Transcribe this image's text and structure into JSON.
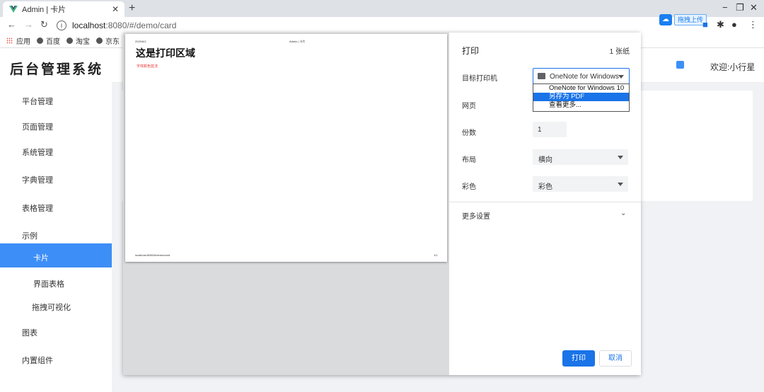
{
  "browser": {
    "tab_title": "Admin | 卡片",
    "new_tab": "+",
    "url_host": "localhost",
    "url_path": ":8080/#/demo/card",
    "window_controls": [
      "−",
      "❐",
      "✕"
    ],
    "upload_ext_label": "拖拽上传",
    "bookmarks": [
      "应用",
      "百度",
      "淘宝",
      "京东"
    ]
  },
  "app": {
    "title": "后台管理系统",
    "welcome": "欢迎:小行星",
    "accent": "#3d8ef7",
    "menu": [
      {
        "label": "平台管理",
        "active": false
      },
      {
        "label": "页面管理",
        "active": false
      },
      {
        "label": "系统管理",
        "active": false
      },
      {
        "label": "字典管理",
        "active": false
      },
      {
        "label": "表格管理",
        "active": false
      },
      {
        "label": "示例",
        "active": false
      },
      {
        "label": "卡片",
        "active": true
      },
      {
        "label": "界面表格",
        "active": false
      },
      {
        "label": "拖拽可视化",
        "active": false
      },
      {
        "label": "图表",
        "active": false
      },
      {
        "label": "内置组件",
        "active": false
      }
    ]
  },
  "print_preview": {
    "date": "2020/6/2",
    "header": "Admin | 卡片",
    "title": "这是打印区域",
    "note": "字体颜色蓝洼",
    "footer_url": "localhost:8080/#/demo/card",
    "page_num": "1/1"
  },
  "print_settings": {
    "title": "打印",
    "sheet_count": "1 张纸",
    "destination_label": "目标打印机",
    "destination_value": "OneNote for Windows",
    "destination_options": [
      "OneNote for Windows 10",
      "另存为 PDF",
      "查看更多..."
    ],
    "destination_selected_index": 1,
    "pages_label": "网页",
    "copies_label": "份数",
    "copies_value": "1",
    "layout_label": "布局",
    "layout_value": "横向",
    "color_label": "彩色",
    "color_value": "彩色",
    "more_settings": "更多设置",
    "print_button": "打印",
    "cancel_button": "取消",
    "primary_color": "#1a73e8"
  }
}
